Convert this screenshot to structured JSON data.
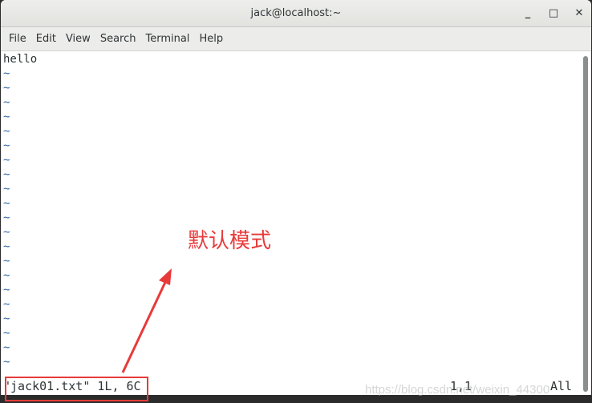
{
  "window": {
    "title": "jack@localhost:~",
    "controls": [
      "minimize",
      "maximize",
      "close"
    ]
  },
  "menu": [
    "File",
    "Edit",
    "View",
    "Search",
    "Terminal",
    "Help"
  ],
  "terminal": {
    "lines": [
      "hello"
    ],
    "tilde": "~",
    "tilde_count": 21,
    "status": {
      "file_info": "\"jack01.txt\" 1L, 6C",
      "position": "1,1",
      "scroll": "All"
    }
  },
  "annotation": {
    "label": "默认模式",
    "color": "#e83a3a"
  },
  "watermark": "https://blog.csdn.net/weixin_44300"
}
